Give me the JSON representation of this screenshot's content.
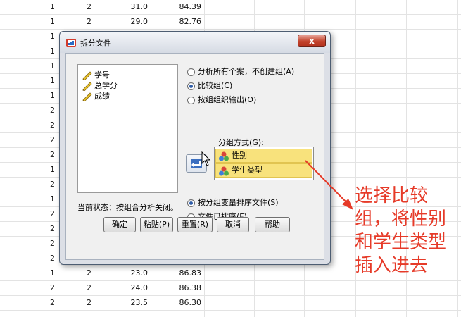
{
  "spreadsheet": {
    "top_rows": [
      {
        "a": "1",
        "b": "2",
        "c": "31.0",
        "d": "84.39"
      },
      {
        "a": "1",
        "b": "2",
        "c": "29.0",
        "d": "82.76"
      }
    ],
    "left_column": [
      "1",
      "1",
      "1",
      "1",
      "1",
      "2",
      "2",
      "2",
      "2",
      "1",
      "2",
      "1",
      "2",
      "2",
      "2",
      "2"
    ],
    "bottom_rows": [
      {
        "a": "1",
        "b": "2",
        "c": "23.0",
        "d": "86.83"
      },
      {
        "a": "2",
        "b": "2",
        "c": "24.0",
        "d": "86.38"
      },
      {
        "a": "2",
        "b": "2",
        "c": "23.5",
        "d": "86.30"
      }
    ]
  },
  "dialog": {
    "title": "拆分文件",
    "close_label": "x",
    "variables": [
      "学号",
      "总学分",
      "成绩"
    ],
    "options": {
      "analyze_all": "分析所有个案，不创建组(A)",
      "compare_groups": "比较组(C)",
      "organize_output": "按组组织输出(O)",
      "selected": "compare_groups"
    },
    "group_label": "分组方式(G):",
    "groups": [
      "性别",
      "学生类型"
    ],
    "sort_options": {
      "sort_by_group": "按分组变量排序文件(S)",
      "already_sorted": "文件已排序(F)",
      "selected": "sort_by_group"
    },
    "status": "当前状态：按组合分析关闭。",
    "buttons": {
      "ok": "确定",
      "paste": "粘贴(P)",
      "reset": "重置(R)",
      "cancel": "取消",
      "help": "帮助"
    }
  },
  "annotation": {
    "lines": [
      "选择比较",
      "组，将性别",
      "和学生类型",
      "插入进去"
    ],
    "color": "#e63a28"
  }
}
